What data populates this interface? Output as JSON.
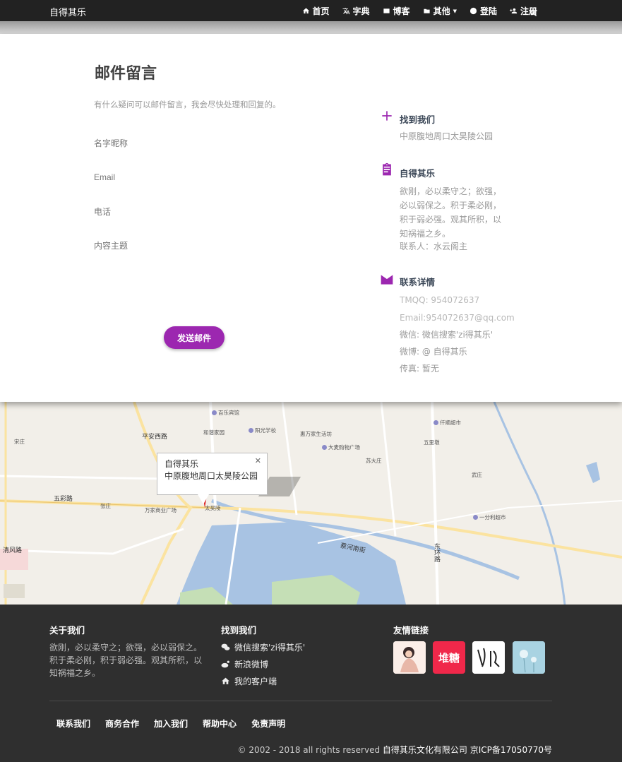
{
  "nav": {
    "brand": "自得其乐",
    "items": [
      {
        "label": "首页",
        "icon": "home-icon"
      },
      {
        "label": "字典",
        "icon": "translate-icon"
      },
      {
        "label": "博客",
        "icon": "blog-icon"
      },
      {
        "label": "其他",
        "icon": "folder-icon"
      },
      {
        "label": "登陆",
        "icon": "account-icon"
      },
      {
        "label": "注册",
        "icon": "add-user-icon"
      }
    ],
    "search_icon": "search-icon"
  },
  "contact": {
    "title": "邮件留言",
    "lead": "有什么疑问可以邮件留言，我会尽快处理和回复的。",
    "fields": {
      "name_placeholder": "名字昵称",
      "email_placeholder": "Email",
      "phone_placeholder": "电话",
      "subject_placeholder": "内容主题"
    },
    "submit_label": "发送邮件"
  },
  "info": {
    "find": {
      "title": "找到我们",
      "text": "中原腹地周口太昊陵公园"
    },
    "about": {
      "title": "自得其乐",
      "text": "欲刚，必以柔守之；欲强，必以弱保之。积于柔必刚，积于弱必强。观其所积，以知祸福之乡。",
      "contact_person": "联系人：水云阁主"
    },
    "details": {
      "title": "联系详情",
      "qq": "TMQQ: 954072637",
      "email": "Email:954072637@qq.com",
      "wechat": "微信: 微信搜索'zi得其乐'",
      "weibo": "微博: @ 自得其乐",
      "fax": "传真: 暂无"
    },
    "accent_color": "#9c27b0"
  },
  "map": {
    "popup_title": "自得其乐",
    "popup_address": "中原腹地周口太昊陵公园",
    "labels": [
      "平安西路",
      "五彩路",
      "清风路",
      "东环路",
      "蔡河南街",
      "太昊陵",
      "百乐宾馆",
      "和谐家园",
      "阳光学校",
      "惠万家生活坊",
      "大麦购物广场",
      "苏大庄",
      "仟顺超市",
      "万家商业广场",
      "张庄",
      "宋庄",
      "五里墩",
      "武庄",
      "一分利超市"
    ]
  },
  "footer": {
    "about_title": "关于我们",
    "about_text": "欲刚，必以柔守之；欲强，必以弱保之。积于柔必刚，积于弱必强。观其所积，以知祸福之乡。",
    "find_title": "找到我们",
    "links": [
      {
        "label": "微信搜索'zi得其乐'",
        "icon": "wechat-icon"
      },
      {
        "label": "新浪微博",
        "icon": "weibo-icon"
      },
      {
        "label": "我的客户端",
        "icon": "home-icon"
      }
    ],
    "friends_title": "友情链接",
    "friend_2_text": "堆糖",
    "bottom_links": [
      "联系我们",
      "商务合作",
      "加入我们",
      "帮助中心",
      "免责声明"
    ],
    "copyright_prefix": "© 2002 - 2018 all rights reserved ",
    "company": "自得其乐文化有限公司",
    "icp": " 京ICP备17050770号"
  }
}
